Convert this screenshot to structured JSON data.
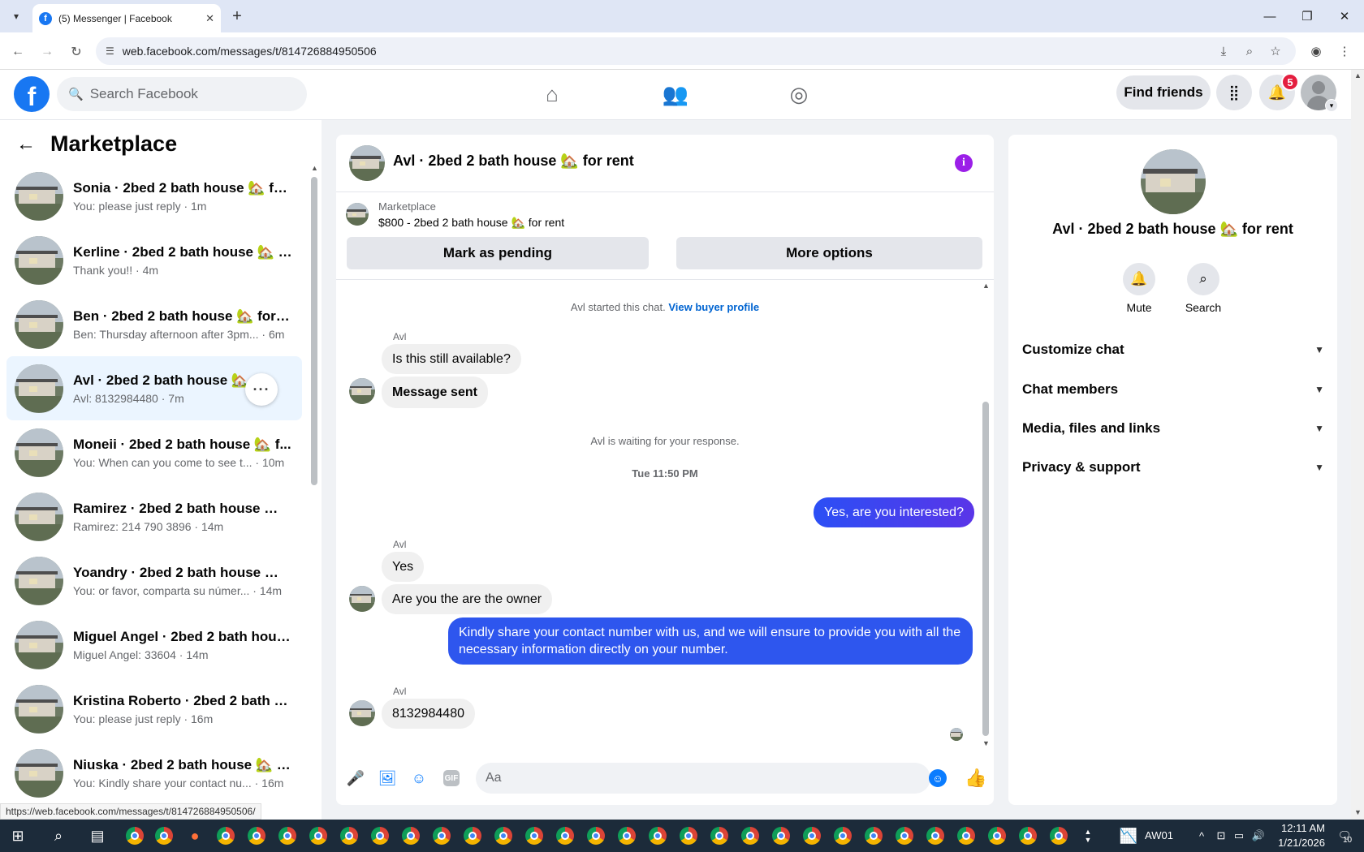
{
  "browser": {
    "tab_title": "(5) Messenger | Facebook",
    "url": "web.facebook.com/messages/t/814726884950506",
    "status_url": "https://web.facebook.com/messages/t/814726884950506/"
  },
  "fb": {
    "search_placeholder": "Search Facebook",
    "find_friends": "Find friends",
    "notifications_count": "5"
  },
  "sidebar": {
    "title": "Marketplace",
    "conversations": [
      {
        "name": "Sonia · 2bed 2 bath house 🏡 fo...",
        "snippet": "You: please just reply · 1m"
      },
      {
        "name": "Kerline · 2bed 2 bath house 🏡 f...",
        "snippet": "Thank you!! · 4m"
      },
      {
        "name": "Ben · 2bed 2 bath house 🏡 for r...",
        "snippet": "Ben: Thursday afternoon after 3pm... · 6m"
      },
      {
        "name": "Avl · 2bed 2 bath house 🏡 fo...",
        "snippet": "Avl: 8132984480 · 7m"
      },
      {
        "name": "Moneii · 2bed 2 bath house 🏡 f...",
        "snippet": "You: When can you come to see t... · 10m"
      },
      {
        "name": "Ramirez · 2bed 2 bath house 🏡 ...",
        "snippet": "Ramirez: 214 790 3896 · 14m"
      },
      {
        "name": "Yoandry · 2bed 2 bath house 🏡 ...",
        "snippet": "You: or favor, comparta su númer... · 14m"
      },
      {
        "name": "Miguel Angel · 2bed 2 bath hous...",
        "snippet": "Miguel Angel: 33604 · 14m"
      },
      {
        "name": "Kristina Roberto · 2bed 2 bath h...",
        "snippet": "You: please just reply · 16m"
      },
      {
        "name": "Niuska · 2bed 2 bath house 🏡 f...",
        "snippet": "You: Kindly share your contact nu... · 16m"
      }
    ]
  },
  "chat": {
    "title": "Avl · 2bed 2 bath house 🏡 for rent",
    "listing_category": "Marketplace",
    "listing_price": "$800 - 2bed 2 bath house 🏡 for rent",
    "mark_pending": "Mark as pending",
    "more_options": "More options",
    "started_text": "Avl started this chat.",
    "view_profile": "View buyer profile",
    "sender": "Avl",
    "msg1": "Is this still available?",
    "msg2": "Message sent",
    "waiting": "Avl is waiting for your response.",
    "timestamp": "Tue 11:50 PM",
    "out1": "Yes, are you interested?",
    "msg3": "Yes",
    "msg4": "Are you the are the owner",
    "out2": "Kindly share your contact number with us, and we will ensure to provide you with all the necessary information directly on your number.",
    "msg5": "8132984480",
    "input_placeholder": "Aa"
  },
  "info": {
    "name": "Avl · 2bed 2 bath house 🏡 for rent",
    "mute": "Mute",
    "search": "Search",
    "sections": [
      "Customize chat",
      "Chat members",
      "Media, files and links",
      "Privacy & support"
    ]
  },
  "taskbar": {
    "stock": "AW01",
    "time": "12:11 AM",
    "date": "1/21/2026",
    "notif": "10"
  }
}
